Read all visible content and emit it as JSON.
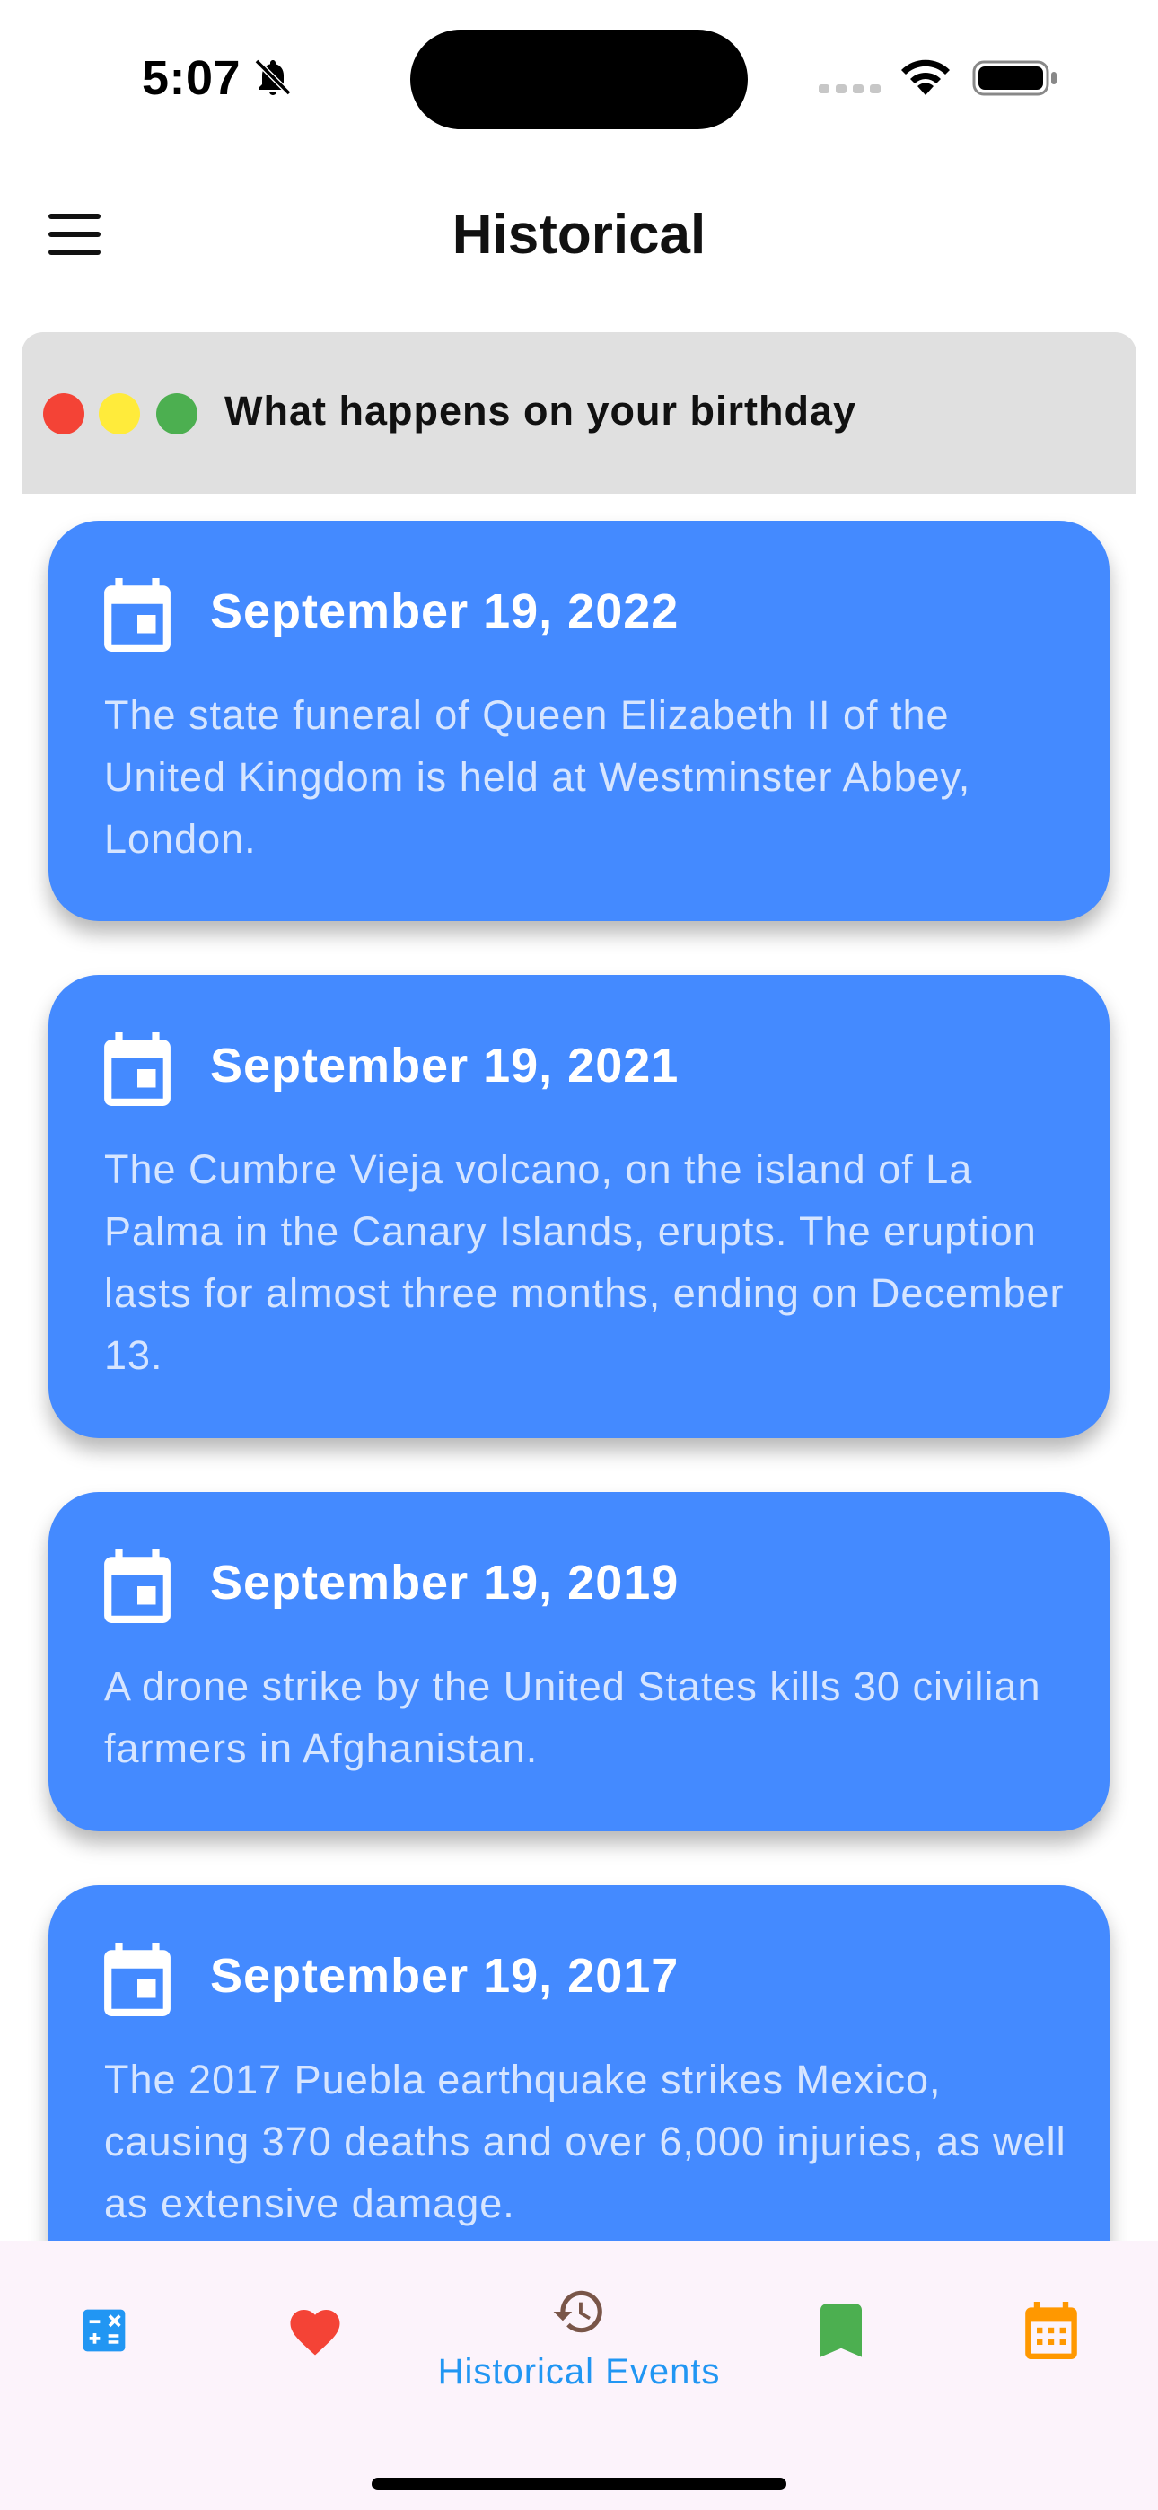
{
  "status_bar": {
    "time": "5:07"
  },
  "app_bar": {
    "title": "Historical"
  },
  "window": {
    "title": "What happens on your birthday"
  },
  "events": [
    {
      "date": "September 19, 2022",
      "text": "The state funeral of Queen Elizabeth II of the United Kingdom is held at Westminster Abbey, London."
    },
    {
      "date": "September 19, 2021",
      "text": "The Cumbre Vieja volcano, on the island of La Palma in the Canary Islands, erupts. The eruption lasts for almost three months, ending on December 13."
    },
    {
      "date": "September 19, 2019",
      "text": "A drone strike by the United States kills 30 civilian farmers in Afghanistan."
    },
    {
      "date": "September 19, 2017",
      "text": "The 2017 Puebla earthquake strikes Mexico, causing 370 deaths and over 6,000 injuries, as well as extensive damage."
    }
  ],
  "bottom_nav": {
    "items": [
      {
        "icon": "calculator-icon",
        "color": "#2196f3"
      },
      {
        "icon": "heart-icon",
        "color": "#f44336"
      },
      {
        "icon": "history-icon",
        "color": "#795548",
        "label": "Historical Events",
        "selected": true
      },
      {
        "icon": "bookmark-icon",
        "color": "#4caf50"
      },
      {
        "icon": "calendar-icon",
        "color": "#ff9800"
      }
    ]
  },
  "colors": {
    "card": "#448aff",
    "window_bar": "#e0e0e0",
    "nav_background": "#fcf3fb",
    "selected_label": "#2196f3"
  }
}
